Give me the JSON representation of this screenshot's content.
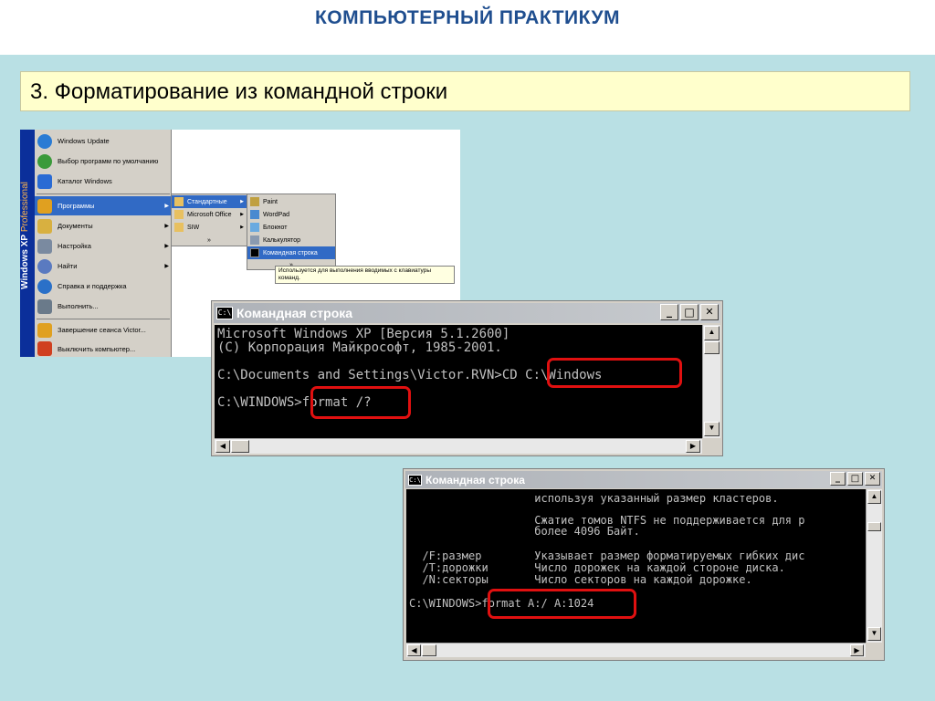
{
  "slide": {
    "title": "КОМПЬЮТЕРНЫЙ ПРАКТИКУМ",
    "subtitle": "3. Форматирование из командной строки"
  },
  "start_menu": {
    "edition_prefix": "Windows XP",
    "edition_suffix": "Professional",
    "items": [
      {
        "label": "Windows Update",
        "icon": "globe-icon",
        "color": "#2a7bd4"
      },
      {
        "label": "Выбор программ по умолчанию",
        "icon": "defaults-icon",
        "color": "#3a9a3a"
      },
      {
        "label": "Каталог Windows",
        "icon": "catalog-icon",
        "color": "#2a6bd4"
      },
      {
        "label": "Программы",
        "icon": "programs-icon",
        "color": "#e0a020"
      },
      {
        "label": "Документы",
        "icon": "documents-icon",
        "color": "#d8b040"
      },
      {
        "label": "Настройка",
        "icon": "settings-icon",
        "color": "#7a8aa0"
      },
      {
        "label": "Найти",
        "icon": "search-icon",
        "color": "#5a7ac0"
      },
      {
        "label": "Справка и поддержка",
        "icon": "help-icon",
        "color": "#2a70c8"
      },
      {
        "label": "Выполнить...",
        "icon": "run-icon",
        "color": "#6a7a8a"
      },
      {
        "label": "Завершение сеанса Victor...",
        "icon": "logoff-icon",
        "color": "#e0a020"
      },
      {
        "label": "Выключить компьютер...",
        "icon": "power-icon",
        "color": "#d04020"
      }
    ],
    "programs_submenu": [
      {
        "label": "Стандартные",
        "icon": "folder-icon"
      },
      {
        "label": "Microsoft Office",
        "icon": "folder-icon"
      },
      {
        "label": "SIW",
        "icon": "folder-icon"
      },
      {
        "label": "»",
        "icon": ""
      }
    ],
    "accessories_submenu": [
      {
        "label": "Paint",
        "icon": "paint-icon"
      },
      {
        "label": "WordPad",
        "icon": "wordpad-icon"
      },
      {
        "label": "Блокнот",
        "icon": "notepad-icon"
      },
      {
        "label": "Калькулятор",
        "icon": "calculator-icon"
      },
      {
        "label": "Командная строка",
        "icon": "cmd-icon"
      },
      {
        "label": "»",
        "icon": ""
      }
    ],
    "tooltip_line1": "Используется для выполнения вводимых с клавиатуры",
    "tooltip_line2": "команд."
  },
  "console1": {
    "title": "Командная строка",
    "icon_text": "C:\\",
    "btn_min": "_",
    "btn_max": "□",
    "btn_close": "✕",
    "lines": [
      "Microsoft Windows XP [Версия 5.1.2600]",
      "(С) Корпорация Майкрософт, 1985-2001.",
      "",
      "C:\\Documents and Settings\\Victor.RVN>CD C:\\Windows",
      "",
      "C:\\WINDOWS>format /?"
    ]
  },
  "console2": {
    "title": "Командная строка",
    "icon_text": "C:\\",
    "btn_min": "_",
    "btn_max": "□",
    "btn_close": "✕",
    "lines": [
      "                   используя указанный размер кластеров.",
      "",
      "                   Сжатие томов NTFS не поддерживается для р",
      "                   более 4096 Байт.",
      "",
      "  /F:размер        Указывает размер форматируемых гибких дис",
      "  /T:дорожки       Число дорожек на каждой стороне диска.",
      "  /N:секторы       Число секторов на каждой дорожке.",
      "",
      "C:\\WINDOWS>format A:/ A:1024"
    ]
  },
  "colors": {
    "title_blue": "#1f4e8f",
    "background": "#b9e0e4",
    "subtitle_bg": "#ffffcc",
    "highlight_red": "#e01010",
    "menu_highlight": "#316ac5"
  }
}
